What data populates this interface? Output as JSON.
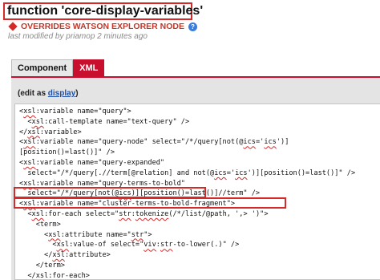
{
  "header": {
    "title": "function 'core-display-variables'",
    "overrides": "OVERRIDES WATSON EXPLORER NODE",
    "help_icon": "?",
    "modified": "last modified by priamop 2 minutes ago"
  },
  "tabs": [
    {
      "label": "Component",
      "active": false
    },
    {
      "label": "XML",
      "active": true
    }
  ],
  "edit": {
    "prefix": "(edit as ",
    "link": "display",
    "suffix": ")"
  },
  "code_lines": [
    [
      "<",
      "xsl",
      ":variable name=\"query\">"
    ],
    [
      "  <",
      "xsl",
      ":call-template name=\"text-query\" />"
    ],
    [
      "</",
      "xsl",
      ":variable>"
    ],
    [
      "<",
      "xsl",
      ":variable name=\"query-node\" select=\"/*/query[not(@",
      "ics",
      "='",
      "ics",
      "')]"
    ],
    [
      "[position()=last()]\" />"
    ],
    [
      "<",
      "xsl",
      ":variable name=\"query-expanded\""
    ],
    [
      "  select=\"/*/query[.//term[@relation] and not(@",
      "ics",
      "='",
      "ics",
      "')][position()=last()]\" />"
    ],
    [
      "<",
      "xsl",
      ":variable name=\"query-terms-to-bold\""
    ],
    [
      "  select=\"/*/query[not(@",
      "ics",
      ")][position()=last()]//term\" />"
    ],
    [
      "<",
      "xsl",
      ":variable name=\"cluster-terms-to-bold-fragment\">"
    ],
    [
      "  <",
      "xsl",
      ":for-each select=\"",
      "str",
      ":",
      "tokenize",
      "(/*/list/@path, ',> ')\">"
    ],
    [
      "    <term>"
    ],
    [
      "      <",
      "xsl",
      ":attribute name=\"",
      "str",
      "\">"
    ],
    [
      "        <",
      "xsl",
      ":value-of select=\"",
      "viv",
      ":",
      "str",
      "-to-lower(.)\" />"
    ],
    [
      "      </",
      "xsl",
      ":attribute>"
    ],
    [
      "    </term>"
    ],
    [
      "  </",
      "xsl",
      ":for-each>"
    ]
  ],
  "colors": {
    "accent": "#c8102e",
    "highlight": "#d42a2a",
    "link": "#1e4fa8"
  },
  "icons": [
    "diamond-icon",
    "help-icon"
  ]
}
